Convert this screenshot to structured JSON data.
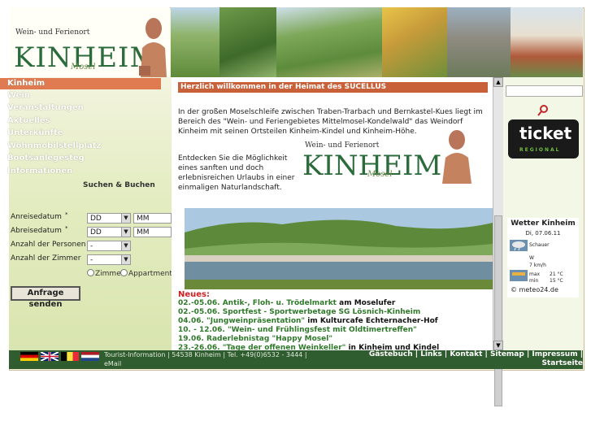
{
  "header": {
    "logo_tagline": "Wein- und Ferienort",
    "logo_name": "KINHEIM",
    "logo_sub": "Mosel"
  },
  "nav": {
    "items": [
      {
        "label": "Kinheim"
      },
      {
        "label": "Wein"
      },
      {
        "label": "Veranstaltungen"
      },
      {
        "label": "Aktuelles"
      },
      {
        "label": "Unterkünfte"
      },
      {
        "label": "Wohnmobilstellplatz"
      },
      {
        "label": "Bootsanlegesteg"
      },
      {
        "label": "Informationen"
      }
    ]
  },
  "search": {
    "title": "Suchen & Buchen",
    "arrival_label": "Anreisedatum",
    "departure_label": "Abreisedatum",
    "persons_label": "Anzahl der Personen",
    "rooms_label": "Anzahl der Zimmer",
    "dd": "DD",
    "mm": "MM",
    "dash": "-",
    "radio_zimmer": "Zimmer",
    "radio_apartment": "Appartment",
    "submit": "Anfrage senden"
  },
  "main": {
    "welcome": "Herzlich willkommen in der Heimat des SUCELLUS",
    "intro": "In der großen Moselschleife zwischen Traben-Trarbach und Bernkastel-Kues liegt im Bereich des \"Wein- und Feriengebietes Mittelmosel-Kondelwald\" das Weindorf Kinheim mit seinen Ortsteilen Kinheim-Kindel und Kinheim-Höhe.",
    "intro2": "Entdecken Sie die Möglichkeit eines sanften und doch erlebnisreichen Urlaubs in einer einmaligen Naturlandschaft.",
    "news_heading": "Neues:",
    "news": [
      {
        "date": "02.-05.06.",
        "title": "Antik-, Floh- u. Trödelmarkt",
        "rest": " am Moselufer"
      },
      {
        "date": "02.-05.06.",
        "title": "Sportfest - Sportwerbetage SG Lösnich-Kinheim",
        "rest": ""
      },
      {
        "date": "04.06.",
        "title": "\"Jungweinpräsentation\"",
        "rest": " im Kulturcafe Echternacher-Hof"
      },
      {
        "date": "10. - 12.06.",
        "title": "\"Wein- und Frühlingsfest mit Oldtimertreffen\"",
        "rest": ""
      },
      {
        "date": "19.06.",
        "title": "Raderlebnistag \"Happy Mosel\"",
        "rest": ""
      },
      {
        "date": "23.-26.06.",
        "title": "\"Tage der offenen Weinkeller\"",
        "rest": " in Kinheim und Kindel"
      }
    ]
  },
  "weather": {
    "title": "Wetter Kinheim",
    "date": "Di, 07.06.11",
    "condition": "Schauer",
    "wind_dir": "W",
    "wind_speed": "7 km/h",
    "max_label": "max",
    "max_val": "21 °C",
    "min_label": "min",
    "min_val": "15 °C",
    "copyright": "© meteo24.de"
  },
  "ticket": {
    "word": "ticket",
    "region": "REGIONAL"
  },
  "footer": {
    "info_line1": "Tourist-Information | 54538 Kinheim | Tel. +49(0)6532 - 3444 |",
    "info_line2": "eMail",
    "links_line1": "Gästebuch | Links | Kontakt | Sitemap | Impressum |",
    "links_line2": "Startseite"
  },
  "colors": {
    "accent": "#c8603a",
    "footer": "#2f5d2f",
    "news_date": "#2f7a2a"
  }
}
